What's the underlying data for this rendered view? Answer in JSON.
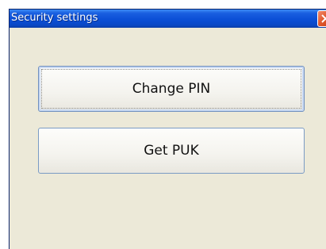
{
  "window": {
    "title": "Security settings"
  },
  "buttons": {
    "change_pin_label": "Change PIN",
    "get_puk_label": "Get PUK"
  },
  "icons": {
    "close": "close-icon"
  },
  "colors": {
    "titlebar": "#0b4fd6",
    "close_button": "#e05a30",
    "window_background": "#ece9d8",
    "button_border": "#7a9bc4"
  }
}
